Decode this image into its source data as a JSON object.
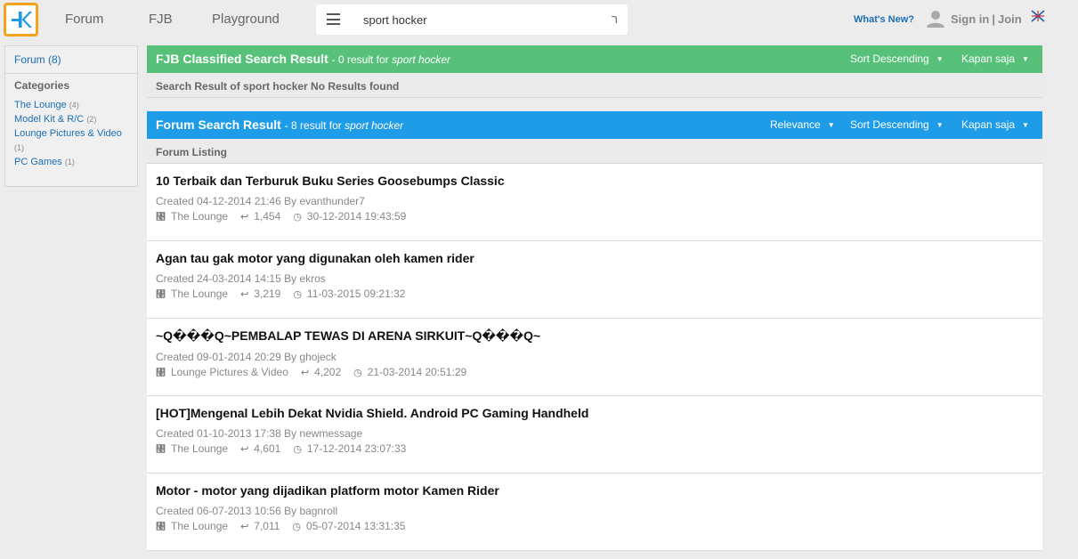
{
  "header": {
    "nav": [
      "Forum",
      "FJB",
      "Playground"
    ],
    "search": {
      "value": "sport hocker",
      "caret": "ר"
    },
    "whats_new": "What's New?",
    "sign_in": "Sign in",
    "separator": "|",
    "join": "Join"
  },
  "sidebar": {
    "forum_count_label": "Forum (8)",
    "categories_title": "Categories",
    "categories": [
      {
        "label": "The Lounge",
        "count": "(4)"
      },
      {
        "label": "Model Kit & R/C",
        "count": "(2)"
      },
      {
        "label": "Lounge Pictures & Video",
        "count": "(1)"
      },
      {
        "label": "PC Games",
        "count": "(1)"
      }
    ]
  },
  "fjb": {
    "title": "FJB Classified Search Result",
    "summary": "- 0 result for",
    "query": "sport hocker",
    "sort_label": "Sort Descending",
    "time_label": "Kapan saja",
    "no_results": "Search Result of sport hocker No Results found"
  },
  "forum": {
    "title": "Forum Search Result",
    "summary": "- 8 result for",
    "query": "sport hocker",
    "relevance_label": "Relevance",
    "sort_label": "Sort Descending",
    "time_label": "Kapan saja",
    "listing_label": "Forum Listing",
    "results": [
      {
        "title": "10 Terbaik dan Terburuk Buku Series Goosebumps Classic",
        "created": "Created 04-12-2014 21:46 By evanthunder7",
        "category": "The Lounge",
        "replies": "1,454",
        "last_post": "30-12-2014 19:43:59"
      },
      {
        "title": "Agan tau gak motor yang digunakan oleh kamen rider",
        "created": "Created 24-03-2014 14:15 By ekros",
        "category": "The Lounge",
        "replies": "3,219",
        "last_post": "11-03-2015 09:21:32"
      },
      {
        "title": "~Q���Q~PEMBALAP TEWAS DI ARENA SIRKUIT~Q���Q~",
        "created": "Created 09-01-2014 20:29 By ghojeck",
        "category": "Lounge Pictures & Video",
        "replies": "4,202",
        "last_post": "21-03-2014 20:51:29"
      },
      {
        "title": "[HOT]Mengenal Lebih Dekat Nvidia Shield. Android PC Gaming Handheld",
        "created": "Created 01-10-2013 17:38 By newmessage",
        "category": "The Lounge",
        "replies": "4,601",
        "last_post": "17-12-2014 23:07:33"
      },
      {
        "title": "Motor - motor yang dijadikan platform motor Kamen Rider",
        "created": "Created 06-07-2013 10:56 By bagnroll",
        "category": "The Lounge",
        "replies": "7,011",
        "last_post": "05-07-2014 13:31:35"
      }
    ]
  },
  "icons": {
    "category": "folder-icon",
    "replies": "reply-icon",
    "last_post": "clock-icon",
    "caret": "caret-down-icon"
  },
  "colors": {
    "fjb_header": "#57c17a",
    "forum_header": "#1e9ce8",
    "logo_border": "#f7a21b",
    "logo_mark": "#1e9ce8",
    "link": "#1a6eb5"
  }
}
